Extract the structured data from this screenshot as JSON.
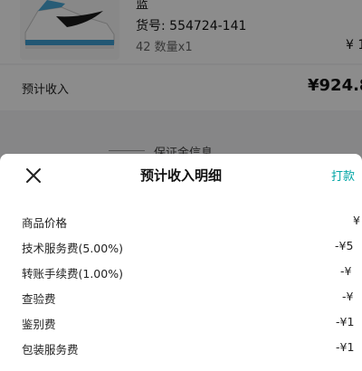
{
  "background": {
    "product": {
      "variant": "蓝",
      "sku": "货号: 554724-141",
      "qty": "42 数量x1",
      "price": "¥ 1"
    },
    "income": {
      "label": "预计收入",
      "value": "¥924.8"
    },
    "deposit_title": "保证金信息"
  },
  "sheet": {
    "title": "预计收入明细",
    "print_label": "打款",
    "rows": [
      {
        "label": "商品价格",
        "value": "¥"
      },
      {
        "label": "技术服务费(5.00%)",
        "value": "-¥5"
      },
      {
        "label": "转账手续费(1.00%)",
        "value": "-¥"
      },
      {
        "label": "查验费",
        "value": "-¥"
      },
      {
        "label": "鉴别费",
        "value": "-¥1"
      },
      {
        "label": "包装服务费",
        "value": "-¥1"
      }
    ]
  },
  "colors": {
    "accent": "#01a5a5",
    "overlay": "rgba(0,0,0,0.45)"
  },
  "icons": [
    "close-icon",
    "sneaker-image"
  ]
}
